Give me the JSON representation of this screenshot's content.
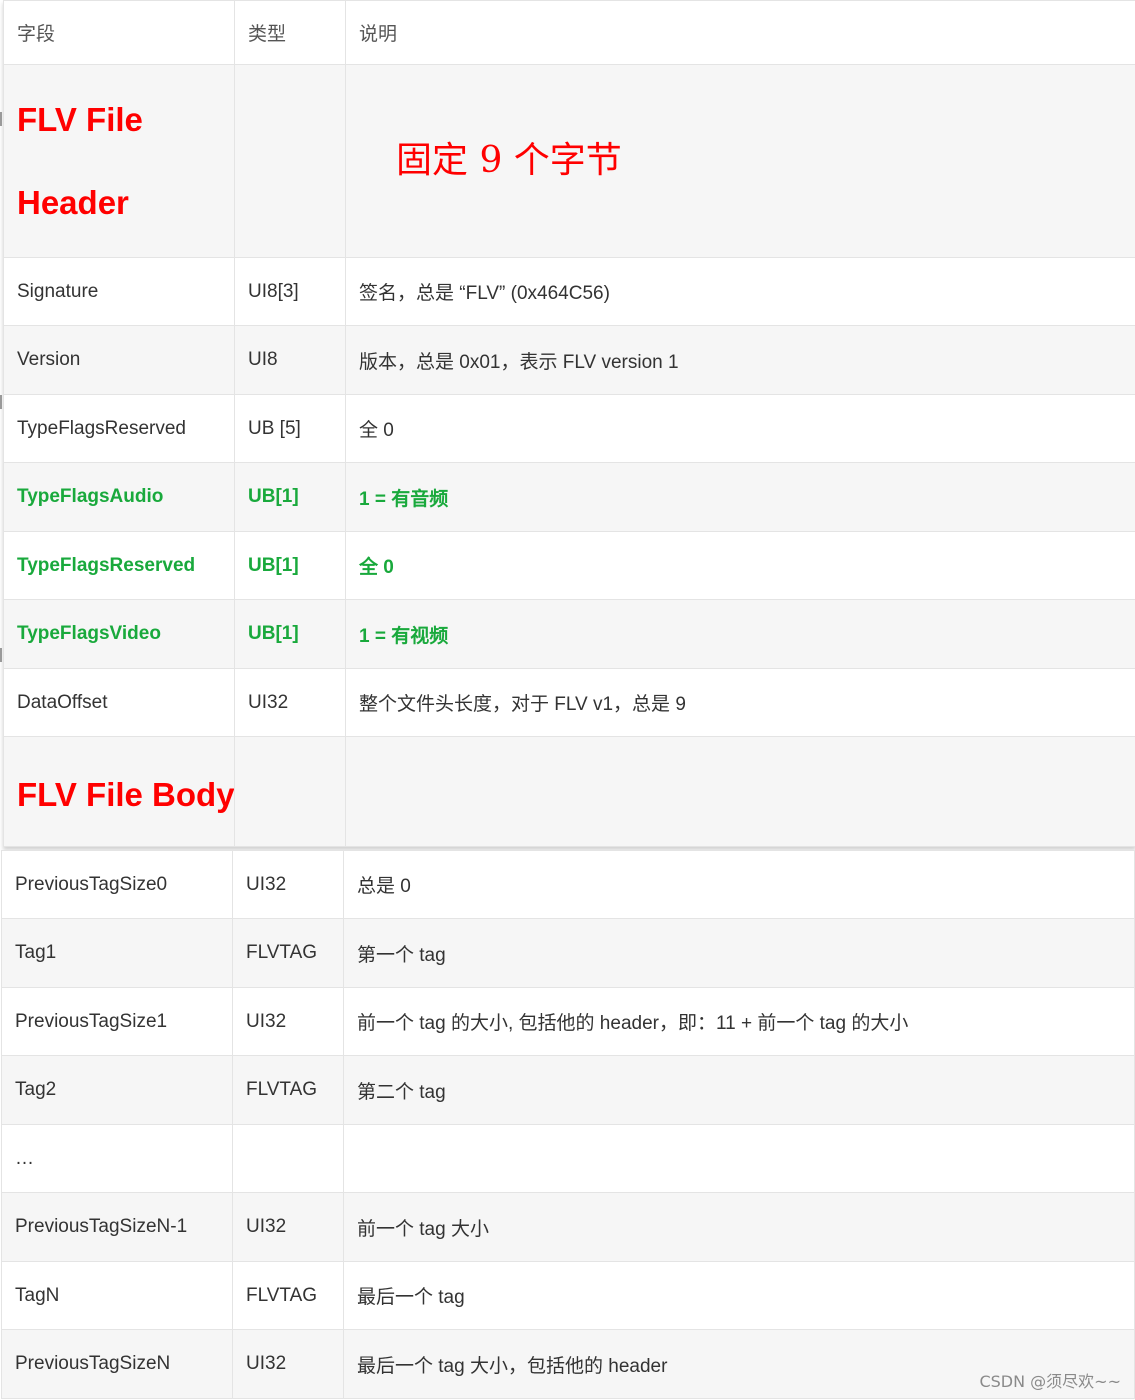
{
  "columns": {
    "field": "字段",
    "type": "类型",
    "desc": "说明"
  },
  "header_section": {
    "title_line1": "FLV File",
    "title_line2": "Header",
    "note": "固定 9 个字节"
  },
  "header_rows": [
    {
      "field": "Signature",
      "type": "UI8[3]",
      "desc": "签名，总是 “FLV” (0x464C56)"
    },
    {
      "field": "Version",
      "type": "UI8",
      "desc": "版本，总是 0x01，表示 FLV version 1"
    },
    {
      "field": "TypeFlagsReserved",
      "type": "UB [5]",
      "desc": "全 0"
    },
    {
      "field": "TypeFlagsAudio",
      "type": "UB[1]",
      "desc": "1 = 有音频"
    },
    {
      "field": "TypeFlagsReserved",
      "type": "UB[1]",
      "desc": "全 0"
    },
    {
      "field": "TypeFlagsVideo",
      "type": "UB[1]",
      "desc": "1 = 有视频"
    },
    {
      "field": "DataOffset",
      "type": "UI32",
      "desc": "整个文件头长度，对于 FLV v1，总是 9"
    }
  ],
  "body_section": {
    "title": "FLV File Body"
  },
  "body_rows": [
    {
      "field": "PreviousTagSize0",
      "type": "UI32",
      "desc": "总是 0"
    },
    {
      "field": "Tag1",
      "type": "FLVTAG",
      "desc": "第一个 tag"
    },
    {
      "field": "PreviousTagSize1",
      "type": "UI32",
      "desc": "前一个 tag 的大小, 包括他的 header，即：11 + 前一个 tag 的大小"
    },
    {
      "field": "Tag2",
      "type": "FLVTAG",
      "desc": "第二个 tag"
    },
    {
      "field": "…",
      "type": "",
      "desc": ""
    },
    {
      "field": "PreviousTagSizeN-1",
      "type": "UI32",
      "desc": "前一个 tag 大小"
    },
    {
      "field": "TagN",
      "type": "FLVTAG",
      "desc": "最后一个 tag"
    },
    {
      "field": "PreviousTagSizeN",
      "type": "UI32",
      "desc": "最后一个 tag 大小，包括他的 header"
    }
  ],
  "watermark": "CSDN @须尽欢~~",
  "colors": {
    "red": "#ff0000",
    "green": "#19a93c",
    "border": "#e4e4e4",
    "shade": "#f6f6f6"
  }
}
